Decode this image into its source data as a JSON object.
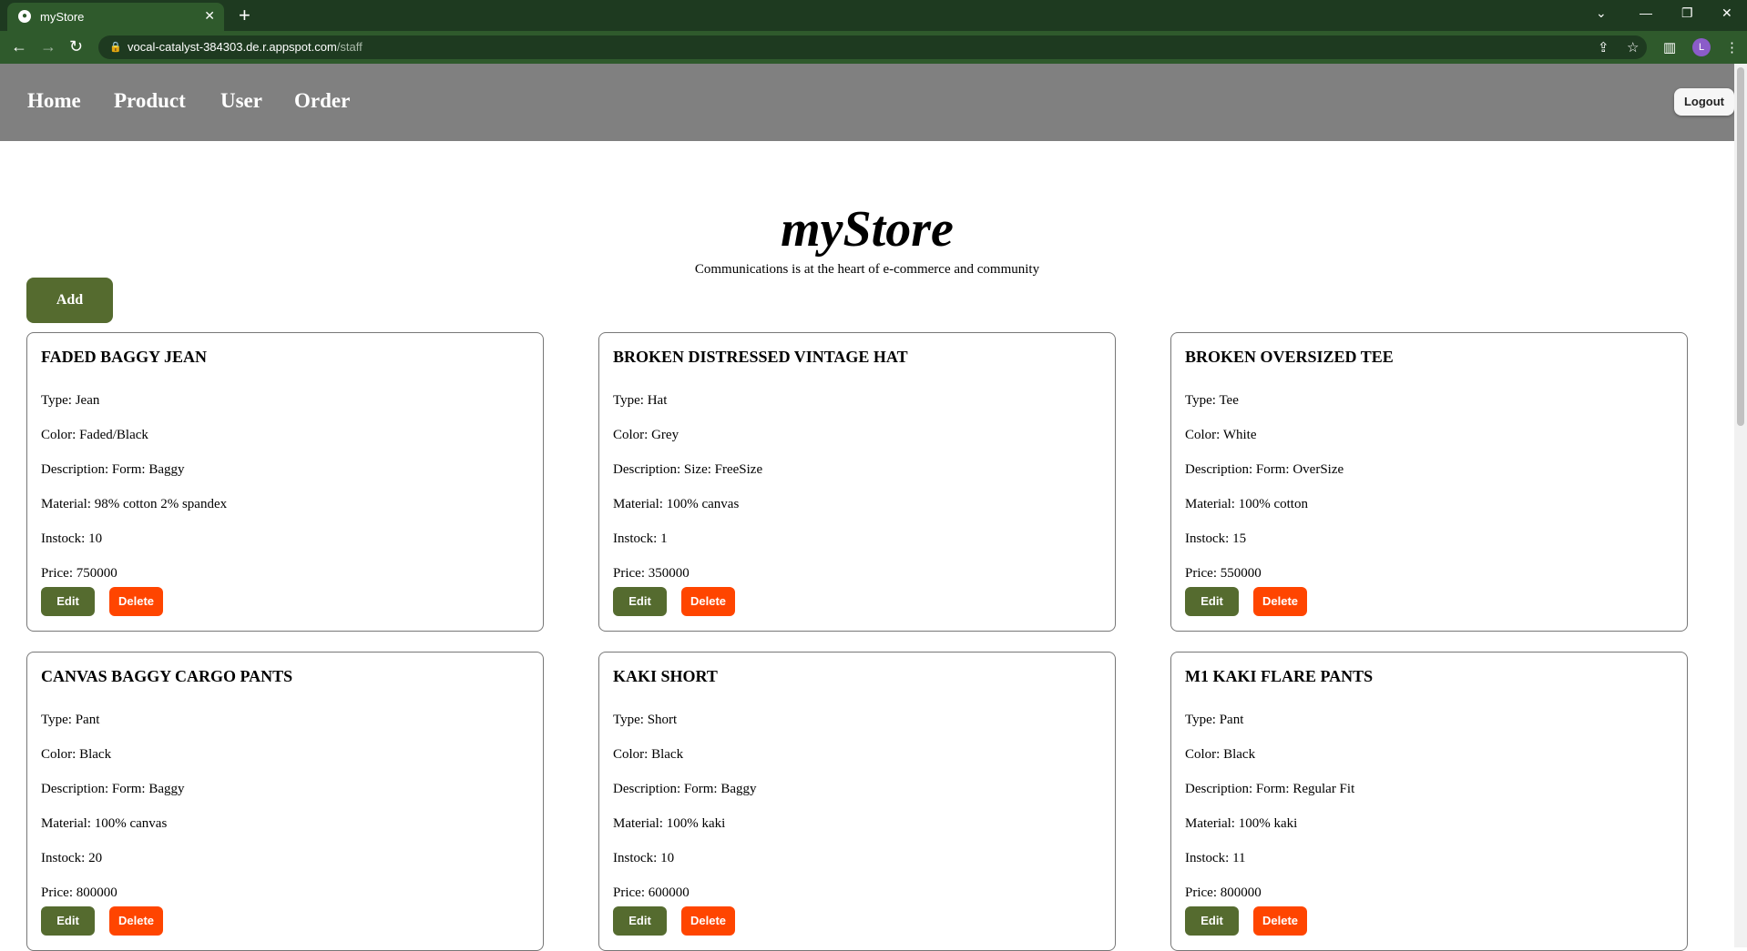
{
  "browser": {
    "tab_title": "myStore",
    "url_host": "vocal-catalyst-384303.de.r.appspot.com",
    "url_path": "/staff",
    "profile_initial": "L"
  },
  "nav": {
    "links": [
      "Home",
      "Product",
      "User",
      "Order"
    ],
    "logout_label": "Logout"
  },
  "header": {
    "brand": "myStore",
    "tagline": "Communications is at the heart of e-commerce and community",
    "add_label": "Add"
  },
  "labels": {
    "type": "Type:",
    "color": "Color:",
    "description": "Description:",
    "material": "Material:",
    "instock": "Instock:",
    "price": "Price:",
    "edit": "Edit",
    "delete": "Delete"
  },
  "products": [
    {
      "name": "FADED BAGGY JEAN",
      "type": "Jean",
      "color": "Faded/Black",
      "description": "Form: Baggy",
      "material": "98% cotton 2% spandex",
      "instock": "10",
      "price": "750000"
    },
    {
      "name": "BROKEN DISTRESSED VINTAGE HAT",
      "type": "Hat",
      "color": "Grey",
      "description": "Size: FreeSize",
      "material": "100% canvas",
      "instock": "1",
      "price": "350000"
    },
    {
      "name": "BROKEN OVERSIZED TEE",
      "type": "Tee",
      "color": "White",
      "description": "Form: OverSize",
      "material": "100% cotton",
      "instock": "15",
      "price": "550000"
    },
    {
      "name": "CANVAS BAGGY CARGO PANTS",
      "type": "Pant",
      "color": "Black",
      "description": "Form: Baggy",
      "material": "100% canvas",
      "instock": "20",
      "price": "800000"
    },
    {
      "name": "KAKI SHORT",
      "type": "Short",
      "color": "Black",
      "description": "Form: Baggy",
      "material": "100% kaki",
      "instock": "10",
      "price": "600000"
    },
    {
      "name": "M1 KAKI FLARE PANTS",
      "type": "Pant",
      "color": "Black",
      "description": "Form: Regular Fit",
      "material": "100% kaki",
      "instock": "11",
      "price": "800000"
    }
  ],
  "colors": {
    "primary_button": "#556b2f",
    "danger_button": "#ff4500",
    "nav_bg": "#808080"
  }
}
